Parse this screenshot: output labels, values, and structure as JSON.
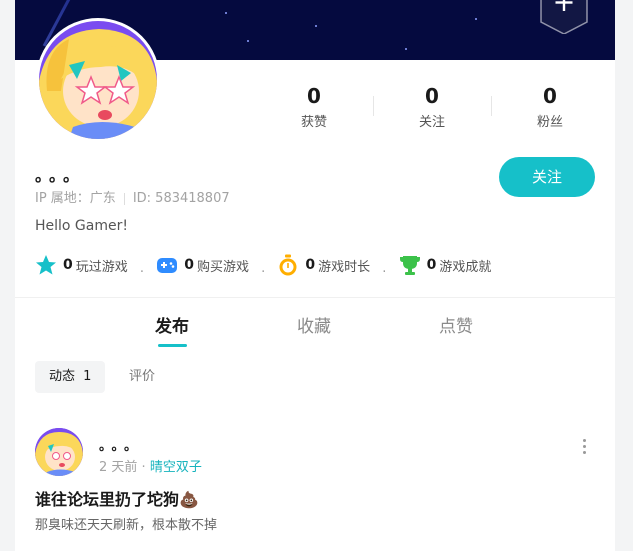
{
  "profile": {
    "nickname": "。。。",
    "ip_label": "IP 属地：广东",
    "id_label": "ID: 583418807",
    "bio": "Hello Gamer!",
    "follow_label": "关注"
  },
  "stats": [
    {
      "value": "0",
      "label": "获赞"
    },
    {
      "value": "0",
      "label": "关注"
    },
    {
      "value": "0",
      "label": "粉丝"
    }
  ],
  "game_stats": [
    {
      "icon": "star-icon",
      "value": "0",
      "label": "玩过游戏",
      "color": "#16c0c9"
    },
    {
      "icon": "gamepad-icon",
      "value": "0",
      "label": "购买游戏",
      "color": "#2f8cff"
    },
    {
      "icon": "timer-icon",
      "value": "0",
      "label": "游戏时长",
      "color": "#ffae00"
    },
    {
      "icon": "trophy-icon",
      "value": "0",
      "label": "游戏成就",
      "color": "#3cc24a"
    }
  ],
  "tabs": [
    {
      "label": "发布",
      "active": true
    },
    {
      "label": "收藏",
      "active": false
    },
    {
      "label": "点赞",
      "active": false
    }
  ],
  "subtabs": [
    {
      "label": "动态",
      "count": "1",
      "active": true
    },
    {
      "label": "评价",
      "active": false
    }
  ],
  "post": {
    "author": "。。。",
    "time": "2 天前",
    "dot": "·",
    "game": "晴空双子",
    "title": "谁往论坛里扔了坨狗💩",
    "body": "那臭味还天天刷新，根本散不掉"
  },
  "colors": {
    "accent": "#16c0c9",
    "banner": "#050a3f"
  }
}
